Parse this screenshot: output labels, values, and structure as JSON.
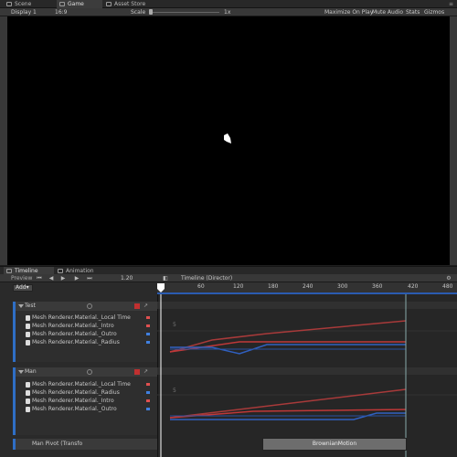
{
  "top_tabs": [
    {
      "label": "Scene"
    },
    {
      "label": "Game"
    },
    {
      "label": "Asset Store"
    }
  ],
  "game_toolbar": {
    "display": "Display 1",
    "aspect": "16:9",
    "scale_label": "Scale",
    "scale_value": "1x",
    "maximize": "Maximize On Play",
    "mute": "Mute Audio",
    "stats": "Stats",
    "gizmos": "Gizmos"
  },
  "bottom_tabs": [
    {
      "label": "Timeline"
    },
    {
      "label": "Animation"
    }
  ],
  "timeline_toolbar": {
    "preview": "Preview",
    "frame": "1.20",
    "title": "Timeline (Director)"
  },
  "ruler_ticks": [
    "60",
    "120",
    "180",
    "240",
    "300",
    "360",
    "420",
    "480"
  ],
  "add_label": "Add",
  "groups": [
    {
      "name": "Test",
      "tracks": [
        {
          "label": "Mesh Renderer.Material._Local Time",
          "color": "#e05050"
        },
        {
          "label": "Mesh Renderer.Material._Intro",
          "color": "#e05050"
        },
        {
          "label": "Mesh Renderer.Material._Outro",
          "color": "#4080e0"
        },
        {
          "label": "Mesh Renderer.Material._Radius",
          "color": "#4080e0"
        }
      ]
    },
    {
      "name": "Man",
      "tracks": [
        {
          "label": "Mesh Renderer.Material._Local Time",
          "color": "#e05050"
        },
        {
          "label": "Mesh Renderer.Material._Radius",
          "color": "#4080e0"
        },
        {
          "label": "Mesh Renderer.Material._Intro",
          "color": "#e05050"
        },
        {
          "label": "Mesh Renderer.Material._Outro",
          "color": "#4080e0"
        }
      ]
    }
  ],
  "curve_label": "5",
  "sub_row_label": "Man Pivot (Transfo",
  "clip_label": "BrownianMotion",
  "colors": {
    "accent_blue": "#2f6ec5",
    "curve_red": "#c03838",
    "curve_blue": "#3060c0",
    "playhead": "#ffffff"
  }
}
